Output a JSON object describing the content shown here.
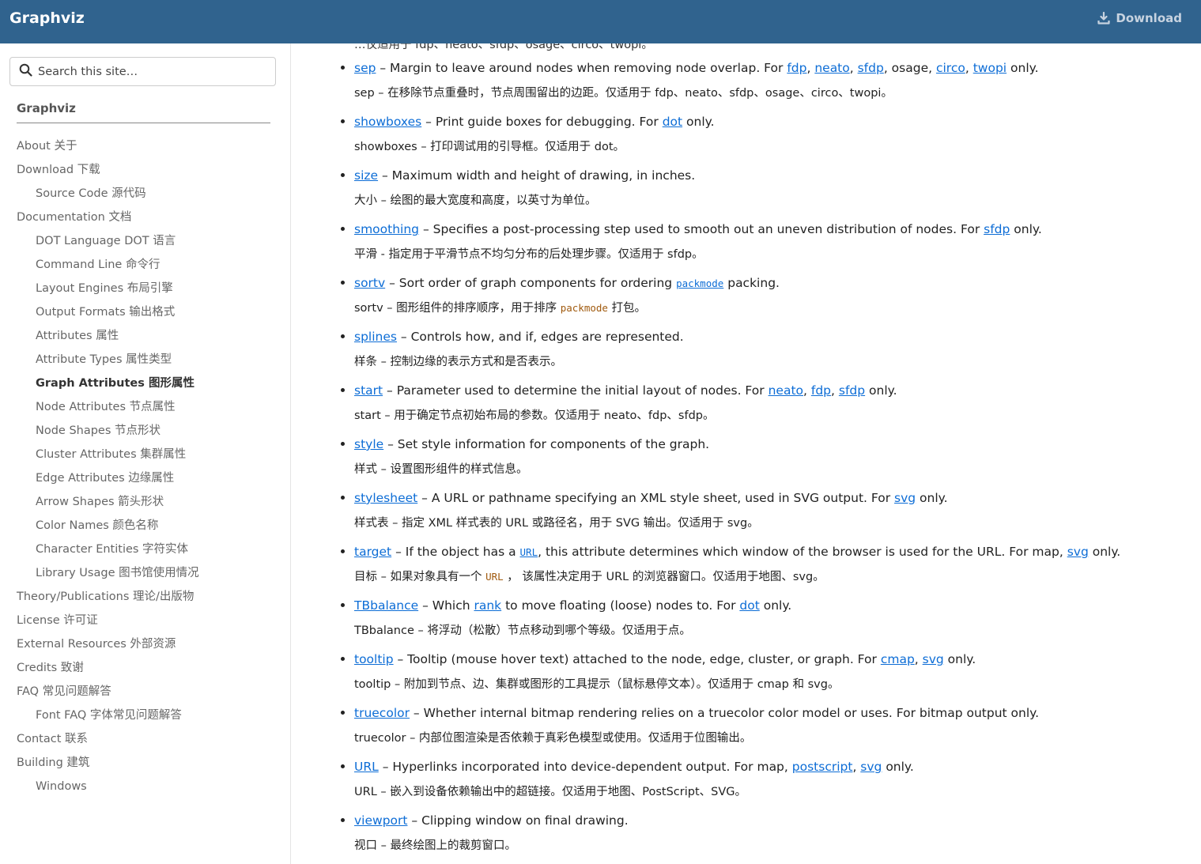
{
  "header": {
    "brand": "Graphviz",
    "download_label": "Download"
  },
  "sidebar": {
    "search_placeholder": "Search this site…",
    "title": "Graphviz",
    "items": [
      {
        "label": "About  关于",
        "level": 1
      },
      {
        "label": "Download  下载",
        "level": 1
      },
      {
        "label": "Source Code  源代码",
        "level": 2
      },
      {
        "label": "Documentation  文档",
        "level": 1
      },
      {
        "label": "DOT Language  DOT 语言",
        "level": 2
      },
      {
        "label": "Command Line  命令行",
        "level": 2
      },
      {
        "label": "Layout Engines  布局引擎",
        "level": 2
      },
      {
        "label": "Output Formats  输出格式",
        "level": 2
      },
      {
        "label": "Attributes  属性",
        "level": 2
      },
      {
        "label": "Attribute Types  属性类型",
        "level": 2
      },
      {
        "label": "Graph Attributes  图形属性",
        "level": 2,
        "active": true
      },
      {
        "label": "Node Attributes  节点属性",
        "level": 2
      },
      {
        "label": "Node Shapes  节点形状",
        "level": 2
      },
      {
        "label": "Cluster Attributes  集群属性",
        "level": 2
      },
      {
        "label": "Edge Attributes  边缘属性",
        "level": 2
      },
      {
        "label": "Arrow Shapes  箭头形状",
        "level": 2
      },
      {
        "label": "Color Names  颜色名称",
        "level": 2
      },
      {
        "label": "Character Entities  字符实体",
        "level": 2
      },
      {
        "label": "Library Usage  图书馆使用情况",
        "level": 2
      },
      {
        "label": "Theory/Publications  理论/出版物",
        "level": 1
      },
      {
        "label": "License  许可证",
        "level": 1
      },
      {
        "label": "External Resources  外部资源",
        "level": 1
      },
      {
        "label": "Credits  致谢",
        "level": 1
      },
      {
        "label": "FAQ  常见问题解答",
        "level": 1
      },
      {
        "label": "Font FAQ  字体常见问题解答",
        "level": 2
      },
      {
        "label": "Contact  联系",
        "level": 1
      },
      {
        "label": "Building  建筑",
        "level": 1
      },
      {
        "label": "Windows",
        "level": 2
      }
    ]
  },
  "content": {
    "clipped_top_line": "…仅适用于 fdp、neato、sfdp、osage、circo、twopi。",
    "attributes": [
      {
        "name": "sep",
        "en": [
          {
            "t": "link",
            "v": "sep"
          },
          {
            "t": "text",
            "v": " – Margin to leave around nodes when removing node overlap. For "
          },
          {
            "t": "link",
            "v": "fdp"
          },
          {
            "t": "text",
            "v": ", "
          },
          {
            "t": "link",
            "v": "neato"
          },
          {
            "t": "text",
            "v": ", "
          },
          {
            "t": "link",
            "v": "sfdp"
          },
          {
            "t": "text",
            "v": ", osage, "
          },
          {
            "t": "link",
            "v": "circo"
          },
          {
            "t": "text",
            "v": ", "
          },
          {
            "t": "link",
            "v": "twopi"
          },
          {
            "t": "text",
            "v": " only."
          }
        ],
        "zh": [
          {
            "t": "text",
            "v": "sep – 在移除节点重叠时，节点周围留出的边距。仅适用于 fdp、neato、sfdp、osage、circo、twopi。"
          }
        ]
      },
      {
        "name": "showboxes",
        "en": [
          {
            "t": "link",
            "v": "showboxes"
          },
          {
            "t": "text",
            "v": " – Print guide boxes for debugging. For "
          },
          {
            "t": "link",
            "v": "dot"
          },
          {
            "t": "text",
            "v": " only."
          }
        ],
        "zh": [
          {
            "t": "text",
            "v": "showboxes – 打印调试用的引导框。仅适用于 dot。"
          }
        ]
      },
      {
        "name": "size",
        "en": [
          {
            "t": "link",
            "v": "size"
          },
          {
            "t": "text",
            "v": " – Maximum width and height of drawing, in inches."
          }
        ],
        "zh": [
          {
            "t": "text",
            "v": "大小 – 绘图的最大宽度和高度，以英寸为单位。"
          }
        ]
      },
      {
        "name": "smoothing",
        "en": [
          {
            "t": "link",
            "v": "smoothing"
          },
          {
            "t": "text",
            "v": " – Specifies a post-processing step used to smooth out an uneven distribution of nodes. For "
          },
          {
            "t": "link",
            "v": "sfdp"
          },
          {
            "t": "text",
            "v": " only."
          }
        ],
        "zh": [
          {
            "t": "text",
            "v": "平滑 - 指定用于平滑节点不均匀分布的后处理步骤。仅适用于 sfdp。"
          }
        ]
      },
      {
        "name": "sortv",
        "en": [
          {
            "t": "link",
            "v": "sortv"
          },
          {
            "t": "text",
            "v": " – Sort order of graph components for ordering "
          },
          {
            "t": "codelink",
            "v": "packmode"
          },
          {
            "t": "text",
            "v": " packing."
          }
        ],
        "zh": [
          {
            "t": "text",
            "v": "sortv – 图形组件的排序顺序，用于排序 "
          },
          {
            "t": "code",
            "v": "packmode"
          },
          {
            "t": "text",
            "v": " 打包。"
          }
        ]
      },
      {
        "name": "splines",
        "en": [
          {
            "t": "link",
            "v": "splines"
          },
          {
            "t": "text",
            "v": " – Controls how, and if, edges are represented."
          }
        ],
        "zh": [
          {
            "t": "text",
            "v": "样条 – 控制边缘的表示方式和是否表示。"
          }
        ]
      },
      {
        "name": "start",
        "en": [
          {
            "t": "link",
            "v": "start"
          },
          {
            "t": "text",
            "v": " – Parameter used to determine the initial layout of nodes. For "
          },
          {
            "t": "link",
            "v": "neato"
          },
          {
            "t": "text",
            "v": ", "
          },
          {
            "t": "link",
            "v": "fdp"
          },
          {
            "t": "text",
            "v": ", "
          },
          {
            "t": "link",
            "v": "sfdp"
          },
          {
            "t": "text",
            "v": " only."
          }
        ],
        "zh": [
          {
            "t": "text",
            "v": "start – 用于确定节点初始布局的参数。仅适用于 neato、fdp、sfdp。"
          }
        ]
      },
      {
        "name": "style",
        "en": [
          {
            "t": "link",
            "v": "style"
          },
          {
            "t": "text",
            "v": " – Set style information for components of the graph."
          }
        ],
        "zh": [
          {
            "t": "text",
            "v": "样式 – 设置图形组件的样式信息。"
          }
        ]
      },
      {
        "name": "stylesheet",
        "en": [
          {
            "t": "link",
            "v": "stylesheet"
          },
          {
            "t": "text",
            "v": " – A URL or pathname specifying an XML style sheet, used in SVG output. For "
          },
          {
            "t": "link",
            "v": "svg"
          },
          {
            "t": "text",
            "v": " only."
          }
        ],
        "zh": [
          {
            "t": "text",
            "v": "样式表 – 指定 XML 样式表的 URL 或路径名，用于 SVG 输出。仅适用于 svg。"
          }
        ]
      },
      {
        "name": "target",
        "en": [
          {
            "t": "link",
            "v": "target"
          },
          {
            "t": "text",
            "v": " – If the object has a "
          },
          {
            "t": "codelink",
            "v": "URL"
          },
          {
            "t": "text",
            "v": ", this attribute determines which window of the browser is used for the URL. For map, "
          },
          {
            "t": "link",
            "v": "svg"
          },
          {
            "t": "text",
            "v": " only."
          }
        ],
        "zh": [
          {
            "t": "text",
            "v": "目标 – 如果对象具有一个 "
          },
          {
            "t": "code",
            "v": "URL"
          },
          {
            "t": "text",
            "v": " ， 该属性决定用于 URL 的浏览器窗口。仅适用于地图、svg。"
          }
        ]
      },
      {
        "name": "TBbalance",
        "en": [
          {
            "t": "link",
            "v": "TBbalance"
          },
          {
            "t": "text",
            "v": " – Which "
          },
          {
            "t": "link",
            "v": "rank"
          },
          {
            "t": "text",
            "v": " to move floating (loose) nodes to. For "
          },
          {
            "t": "link",
            "v": "dot"
          },
          {
            "t": "text",
            "v": " only."
          }
        ],
        "zh": [
          {
            "t": "text",
            "v": "TBbalance – 将浮动（松散）节点移动到哪个等级。仅适用于点。"
          }
        ]
      },
      {
        "name": "tooltip",
        "en": [
          {
            "t": "link",
            "v": "tooltip"
          },
          {
            "t": "text",
            "v": " – Tooltip (mouse hover text) attached to the node, edge, cluster, or graph. For "
          },
          {
            "t": "link",
            "v": "cmap"
          },
          {
            "t": "text",
            "v": ", "
          },
          {
            "t": "link",
            "v": "svg"
          },
          {
            "t": "text",
            "v": " only."
          }
        ],
        "zh": [
          {
            "t": "text",
            "v": "tooltip – 附加到节点、边、集群或图形的工具提示（鼠标悬停文本）。仅适用于 cmap 和 svg。"
          }
        ]
      },
      {
        "name": "truecolor",
        "en": [
          {
            "t": "link",
            "v": "truecolor"
          },
          {
            "t": "text",
            "v": " – Whether internal bitmap rendering relies on a truecolor color model or uses. For bitmap output only."
          }
        ],
        "zh": [
          {
            "t": "text",
            "v": "truecolor – 内部位图渲染是否依赖于真彩色模型或使用。仅适用于位图输出。"
          }
        ]
      },
      {
        "name": "URL",
        "en": [
          {
            "t": "link",
            "v": "URL"
          },
          {
            "t": "text",
            "v": " – Hyperlinks incorporated into device-dependent output. For map, "
          },
          {
            "t": "link",
            "v": "postscript"
          },
          {
            "t": "text",
            "v": ", "
          },
          {
            "t": "link",
            "v": "svg"
          },
          {
            "t": "text",
            "v": " only."
          }
        ],
        "zh": [
          {
            "t": "text",
            "v": "URL – 嵌入到设备依赖输出中的超链接。仅适用于地图、PostScript、SVG。"
          }
        ]
      },
      {
        "name": "viewport",
        "en": [
          {
            "t": "link",
            "v": "viewport"
          },
          {
            "t": "text",
            "v": " – Clipping window on final drawing."
          }
        ],
        "zh": [
          {
            "t": "text",
            "v": "视口 – 最终绘图上的裁剪窗口。"
          }
        ]
      }
    ]
  },
  "colors": {
    "header_bg": "#30638e",
    "link": "#0d6dd6",
    "code_plain": "#a05a0e"
  }
}
